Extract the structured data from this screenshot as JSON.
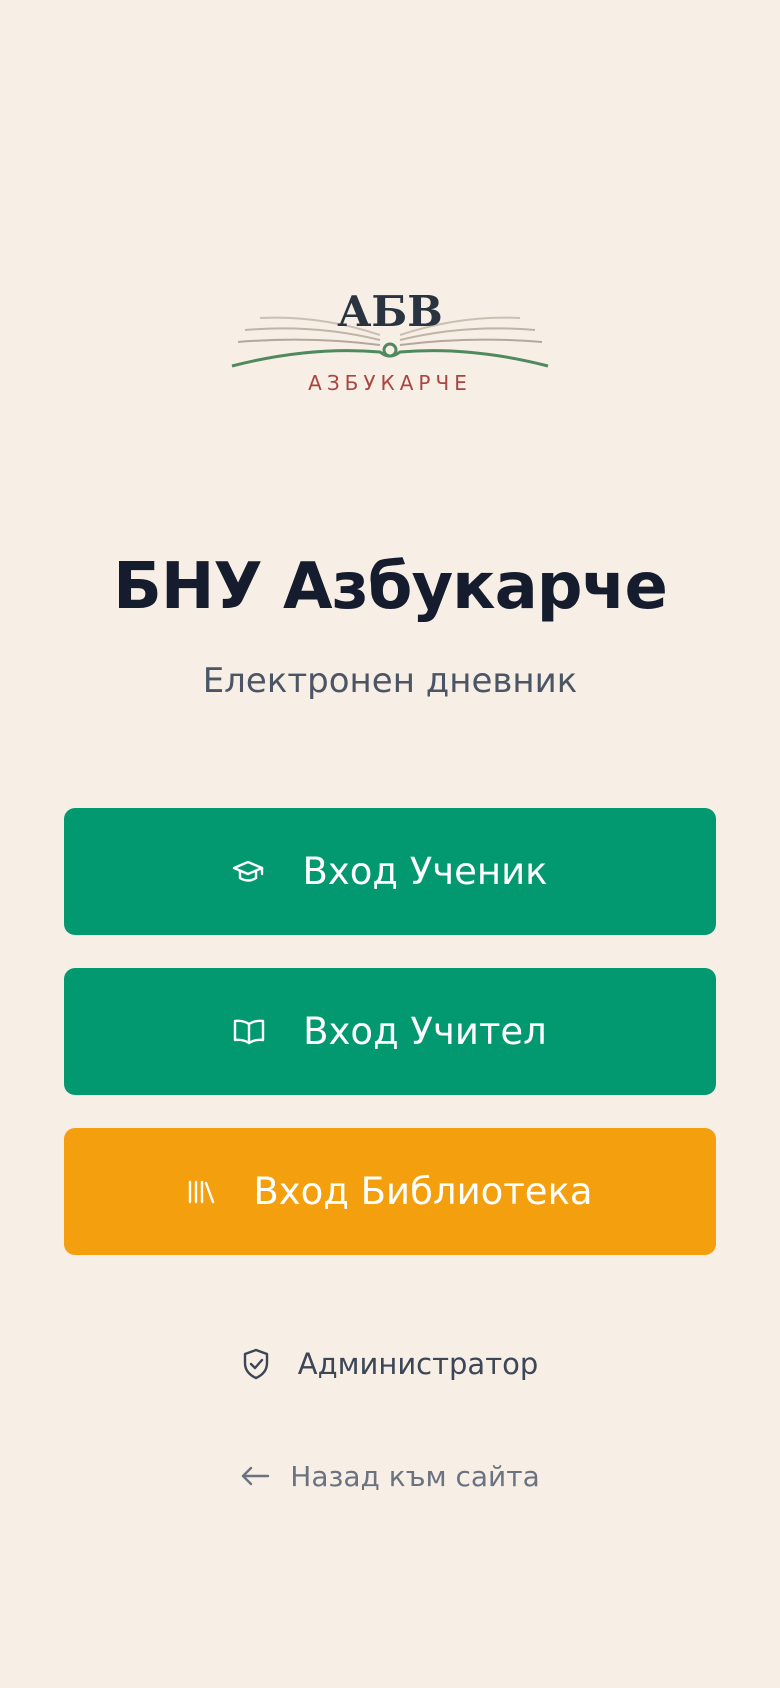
{
  "logo": {
    "monogram": "АБВ",
    "wordmark": "АЗБУКАРЧЕ",
    "colors": {
      "monogram": "#2A3340",
      "wordmark": "#A8463F",
      "book_line": "#4E8A5E",
      "book_pages": "#B9AEA2"
    }
  },
  "header": {
    "title": "БНУ Азбукарче",
    "subtitle": "Електронен дневник"
  },
  "buttons": {
    "student": {
      "label": "Вход Ученик",
      "icon": "graduation-cap-icon",
      "color": "#039970"
    },
    "teacher": {
      "label": "Вход Учител",
      "icon": "open-book-icon",
      "color": "#039970"
    },
    "library": {
      "label": "Вход Библиотека",
      "icon": "library-shelf-icon",
      "color": "#F49F0E"
    }
  },
  "admin": {
    "label": "Администратор",
    "icon": "shield-check-icon"
  },
  "back": {
    "label": "Назад към сайта",
    "icon": "arrow-left-icon"
  },
  "theme": {
    "background": "#F7EEE5",
    "title_color": "#141C2E",
    "subtitle_color": "#4B5565"
  }
}
